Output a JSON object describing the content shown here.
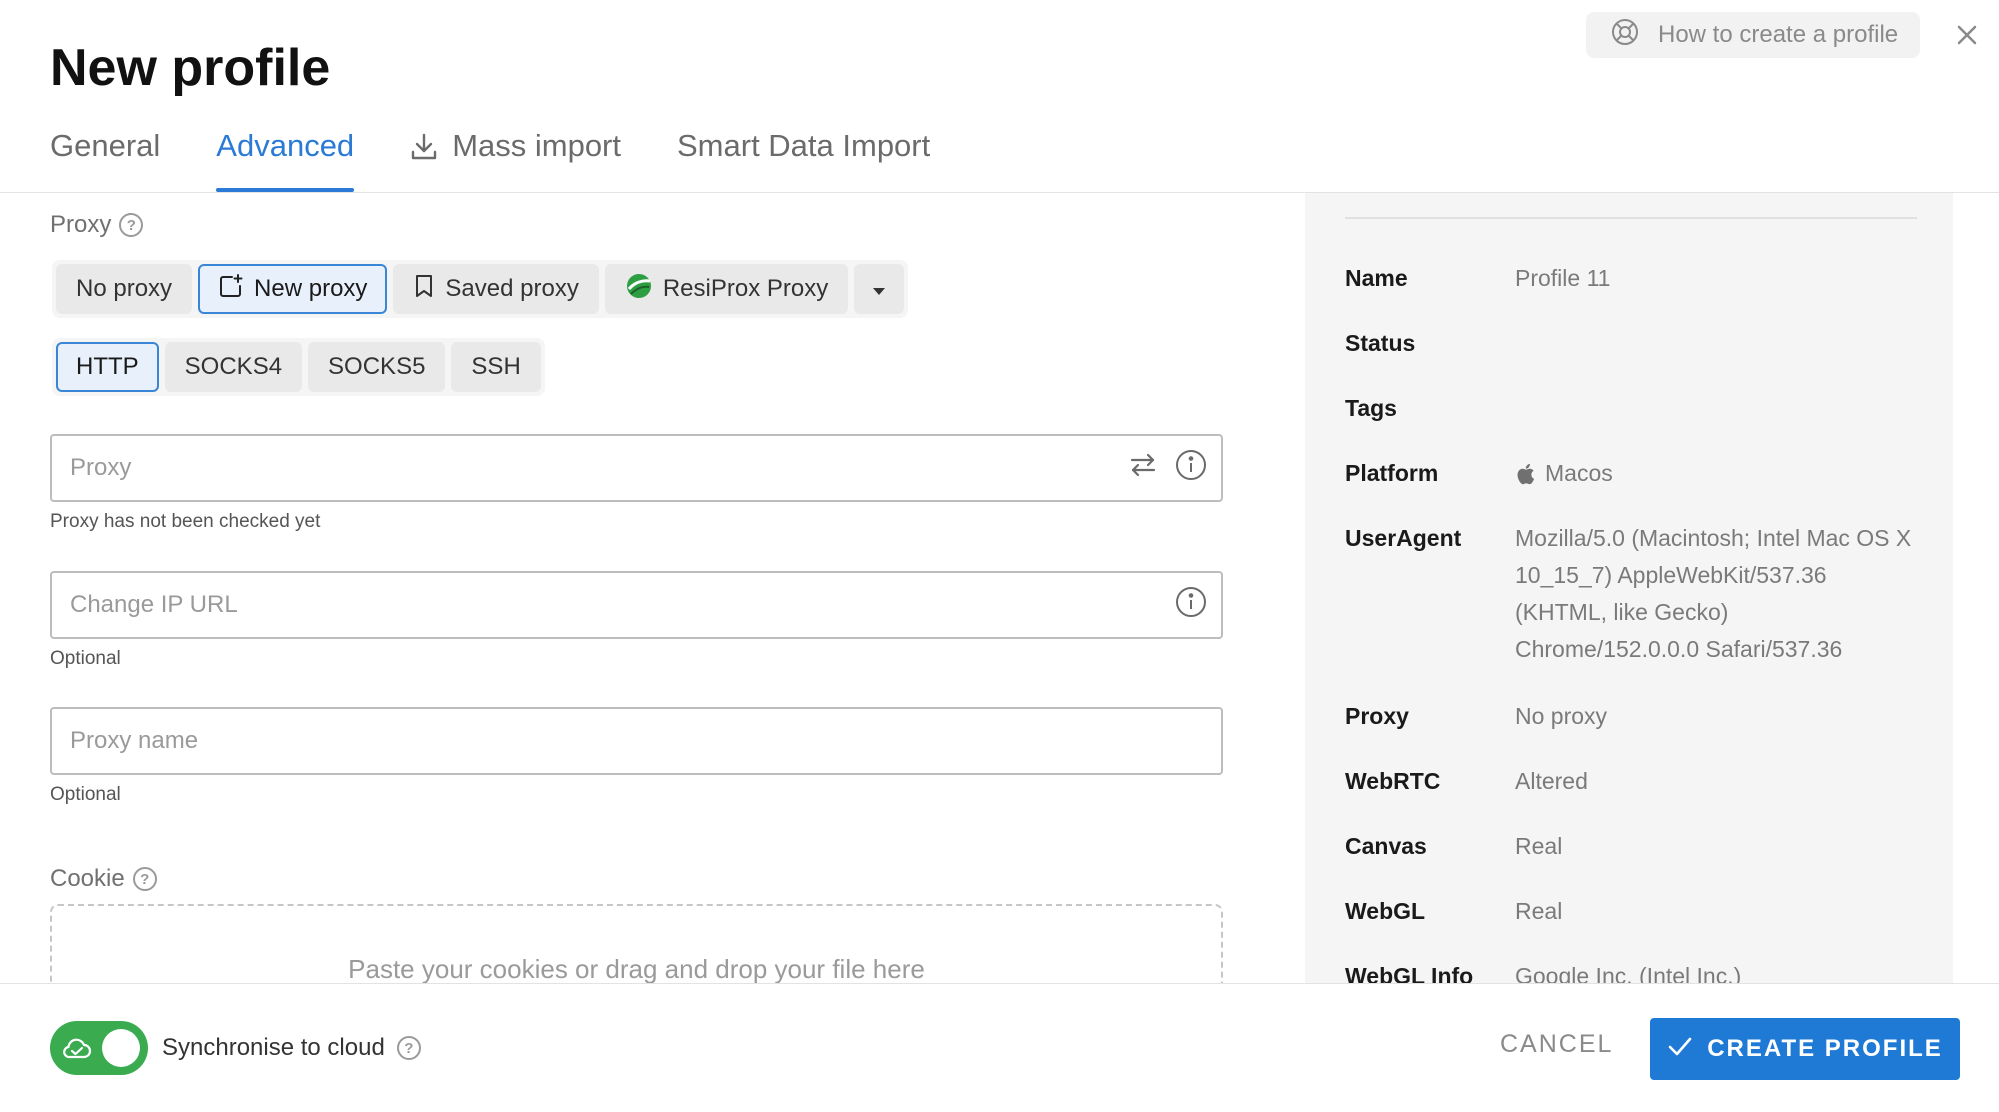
{
  "header": {
    "title": "New profile",
    "help_label": "How to create a profile"
  },
  "tabs": [
    {
      "label": "General",
      "active": false
    },
    {
      "label": "Advanced",
      "active": true
    },
    {
      "label": "Mass import",
      "active": false
    },
    {
      "label": "Smart Data Import",
      "active": false
    }
  ],
  "proxy": {
    "section_label": "Proxy",
    "modes": [
      "No proxy",
      "New proxy",
      "Saved proxy",
      "ResiProx Proxy"
    ],
    "active_mode": "New proxy",
    "types": [
      "HTTP",
      "SOCKS4",
      "SOCKS5",
      "SSH"
    ],
    "active_type": "HTTP",
    "proxy_placeholder": "Proxy",
    "proxy_helper": "Proxy has not been checked yet",
    "change_ip_placeholder": "Change IP URL",
    "change_ip_helper": "Optional",
    "name_placeholder": "Proxy name",
    "name_helper": "Optional"
  },
  "cookie": {
    "section_label": "Cookie",
    "dropzone_text": "Paste your cookies or drag and drop your file here"
  },
  "summary": {
    "rows": [
      {
        "key": "Name",
        "value": "Profile 11"
      },
      {
        "key": "Status",
        "value": ""
      },
      {
        "key": "Tags",
        "value": ""
      },
      {
        "key": "Platform",
        "value": "Macos",
        "icon": "apple-icon"
      },
      {
        "key": "UserAgent",
        "value": "Mozilla/5.0 (Macintosh; Intel Mac OS X 10_15_7) AppleWebKit/537.36 (KHTML, like Gecko) Chrome/152.0.0.0 Safari/537.36"
      },
      {
        "key": "Proxy",
        "value": "No proxy"
      },
      {
        "key": "WebRTC",
        "value": "Altered"
      },
      {
        "key": "Canvas",
        "value": "Real"
      },
      {
        "key": "WebGL",
        "value": "Real"
      },
      {
        "key": "WebGL Info",
        "value": "Google Inc. (Intel Inc.)"
      }
    ]
  },
  "footer": {
    "sync_label": "Synchronise to cloud",
    "sync_enabled": true,
    "cancel_label": "CANCEL",
    "create_label": "CREATE PROFILE"
  },
  "colors": {
    "accent": "#1f7ad6",
    "toggle_on": "#3aab4f"
  }
}
